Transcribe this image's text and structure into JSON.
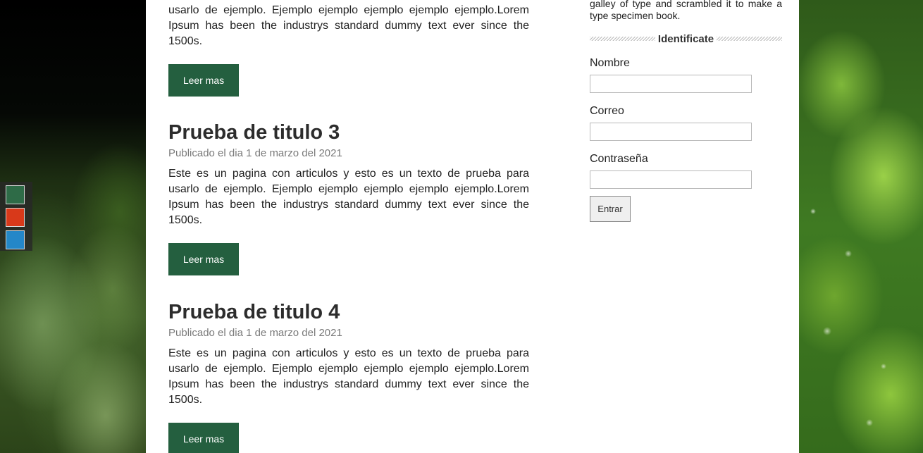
{
  "theme": {
    "accent": "#245f3f",
    "swatches": [
      {
        "name": "green",
        "color": "#2e6b47"
      },
      {
        "name": "red",
        "color": "#d8391a"
      },
      {
        "name": "blue",
        "color": "#2487c8"
      }
    ]
  },
  "articles": [
    {
      "title": "",
      "date": "",
      "body": "usarlo de ejemplo. Ejemplo ejemplo ejemplo ejemplo ejemplo.Lorem Ipsum has been the industrys standard dummy text ever since the 1500s.",
      "button": "Leer mas"
    },
    {
      "title": "Prueba de titulo 3",
      "date": "Publicado el dia 1 de marzo del 2021",
      "body": "Este es un pagina con articulos y esto es un texto de prueba para usarlo de ejemplo. Ejemplo ejemplo ejemplo ejemplo ejemplo.Lorem Ipsum has been the industrys standard dummy text ever since the 1500s.",
      "button": "Leer mas"
    },
    {
      "title": "Prueba de titulo 4",
      "date": "Publicado el dia 1 de marzo del 2021",
      "body": "Este es un pagina con articulos y esto es un texto de prueba para usarlo de ejemplo. Ejemplo ejemplo ejemplo ejemplo ejemplo.Lorem Ipsum has been the industrys standard dummy text ever since the 1500s.",
      "button": "Leer mas"
    }
  ],
  "sidebar": {
    "top_text": "galley of type and scrambled it to make a type specimen book.",
    "login": {
      "title": "Identificate",
      "name_label": "Nombre",
      "email_label": "Correo",
      "password_label": "Contraseña",
      "submit_label": "Entrar"
    }
  }
}
